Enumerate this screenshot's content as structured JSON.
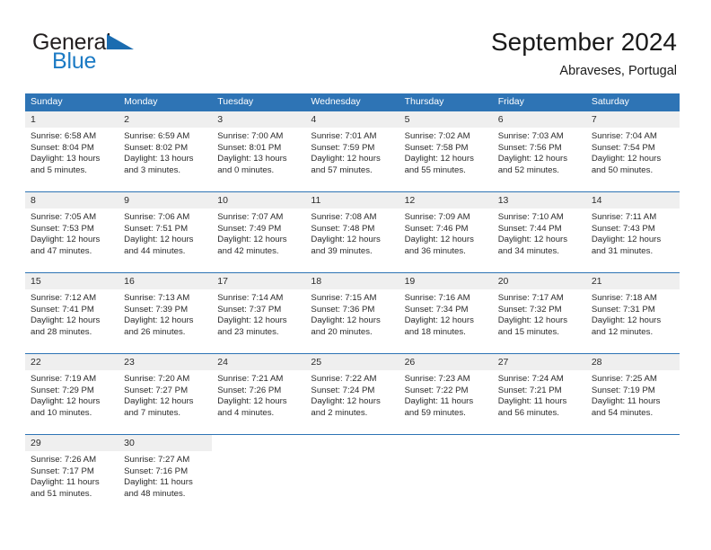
{
  "brand": {
    "name_part1": "General",
    "name_part2": "Blue",
    "flag_icon": "flag-triangle-icon",
    "color_dark": "#231f20",
    "color_blue": "#1b7ac4"
  },
  "header": {
    "title": "September 2024",
    "subtitle": "Abraveses, Portugal"
  },
  "colors": {
    "header_blue": "#2e74b5",
    "day_number_bg": "#efefef",
    "text": "#2b2b2b"
  },
  "weekdays": [
    "Sunday",
    "Monday",
    "Tuesday",
    "Wednesday",
    "Thursday",
    "Friday",
    "Saturday"
  ],
  "weeks": [
    [
      {
        "day": "1",
        "sunrise": "Sunrise: 6:58 AM",
        "sunset": "Sunset: 8:04 PM",
        "daylight": "Daylight: 13 hours and 5 minutes."
      },
      {
        "day": "2",
        "sunrise": "Sunrise: 6:59 AM",
        "sunset": "Sunset: 8:02 PM",
        "daylight": "Daylight: 13 hours and 3 minutes."
      },
      {
        "day": "3",
        "sunrise": "Sunrise: 7:00 AM",
        "sunset": "Sunset: 8:01 PM",
        "daylight": "Daylight: 13 hours and 0 minutes."
      },
      {
        "day": "4",
        "sunrise": "Sunrise: 7:01 AM",
        "sunset": "Sunset: 7:59 PM",
        "daylight": "Daylight: 12 hours and 57 minutes."
      },
      {
        "day": "5",
        "sunrise": "Sunrise: 7:02 AM",
        "sunset": "Sunset: 7:58 PM",
        "daylight": "Daylight: 12 hours and 55 minutes."
      },
      {
        "day": "6",
        "sunrise": "Sunrise: 7:03 AM",
        "sunset": "Sunset: 7:56 PM",
        "daylight": "Daylight: 12 hours and 52 minutes."
      },
      {
        "day": "7",
        "sunrise": "Sunrise: 7:04 AM",
        "sunset": "Sunset: 7:54 PM",
        "daylight": "Daylight: 12 hours and 50 minutes."
      }
    ],
    [
      {
        "day": "8",
        "sunrise": "Sunrise: 7:05 AM",
        "sunset": "Sunset: 7:53 PM",
        "daylight": "Daylight: 12 hours and 47 minutes."
      },
      {
        "day": "9",
        "sunrise": "Sunrise: 7:06 AM",
        "sunset": "Sunset: 7:51 PM",
        "daylight": "Daylight: 12 hours and 44 minutes."
      },
      {
        "day": "10",
        "sunrise": "Sunrise: 7:07 AM",
        "sunset": "Sunset: 7:49 PM",
        "daylight": "Daylight: 12 hours and 42 minutes."
      },
      {
        "day": "11",
        "sunrise": "Sunrise: 7:08 AM",
        "sunset": "Sunset: 7:48 PM",
        "daylight": "Daylight: 12 hours and 39 minutes."
      },
      {
        "day": "12",
        "sunrise": "Sunrise: 7:09 AM",
        "sunset": "Sunset: 7:46 PM",
        "daylight": "Daylight: 12 hours and 36 minutes."
      },
      {
        "day": "13",
        "sunrise": "Sunrise: 7:10 AM",
        "sunset": "Sunset: 7:44 PM",
        "daylight": "Daylight: 12 hours and 34 minutes."
      },
      {
        "day": "14",
        "sunrise": "Sunrise: 7:11 AM",
        "sunset": "Sunset: 7:43 PM",
        "daylight": "Daylight: 12 hours and 31 minutes."
      }
    ],
    [
      {
        "day": "15",
        "sunrise": "Sunrise: 7:12 AM",
        "sunset": "Sunset: 7:41 PM",
        "daylight": "Daylight: 12 hours and 28 minutes."
      },
      {
        "day": "16",
        "sunrise": "Sunrise: 7:13 AM",
        "sunset": "Sunset: 7:39 PM",
        "daylight": "Daylight: 12 hours and 26 minutes."
      },
      {
        "day": "17",
        "sunrise": "Sunrise: 7:14 AM",
        "sunset": "Sunset: 7:37 PM",
        "daylight": "Daylight: 12 hours and 23 minutes."
      },
      {
        "day": "18",
        "sunrise": "Sunrise: 7:15 AM",
        "sunset": "Sunset: 7:36 PM",
        "daylight": "Daylight: 12 hours and 20 minutes."
      },
      {
        "day": "19",
        "sunrise": "Sunrise: 7:16 AM",
        "sunset": "Sunset: 7:34 PM",
        "daylight": "Daylight: 12 hours and 18 minutes."
      },
      {
        "day": "20",
        "sunrise": "Sunrise: 7:17 AM",
        "sunset": "Sunset: 7:32 PM",
        "daylight": "Daylight: 12 hours and 15 minutes."
      },
      {
        "day": "21",
        "sunrise": "Sunrise: 7:18 AM",
        "sunset": "Sunset: 7:31 PM",
        "daylight": "Daylight: 12 hours and 12 minutes."
      }
    ],
    [
      {
        "day": "22",
        "sunrise": "Sunrise: 7:19 AM",
        "sunset": "Sunset: 7:29 PM",
        "daylight": "Daylight: 12 hours and 10 minutes."
      },
      {
        "day": "23",
        "sunrise": "Sunrise: 7:20 AM",
        "sunset": "Sunset: 7:27 PM",
        "daylight": "Daylight: 12 hours and 7 minutes."
      },
      {
        "day": "24",
        "sunrise": "Sunrise: 7:21 AM",
        "sunset": "Sunset: 7:26 PM",
        "daylight": "Daylight: 12 hours and 4 minutes."
      },
      {
        "day": "25",
        "sunrise": "Sunrise: 7:22 AM",
        "sunset": "Sunset: 7:24 PM",
        "daylight": "Daylight: 12 hours and 2 minutes."
      },
      {
        "day": "26",
        "sunrise": "Sunrise: 7:23 AM",
        "sunset": "Sunset: 7:22 PM",
        "daylight": "Daylight: 11 hours and 59 minutes."
      },
      {
        "day": "27",
        "sunrise": "Sunrise: 7:24 AM",
        "sunset": "Sunset: 7:21 PM",
        "daylight": "Daylight: 11 hours and 56 minutes."
      },
      {
        "day": "28",
        "sunrise": "Sunrise: 7:25 AM",
        "sunset": "Sunset: 7:19 PM",
        "daylight": "Daylight: 11 hours and 54 minutes."
      }
    ],
    [
      {
        "day": "29",
        "sunrise": "Sunrise: 7:26 AM",
        "sunset": "Sunset: 7:17 PM",
        "daylight": "Daylight: 11 hours and 51 minutes."
      },
      {
        "day": "30",
        "sunrise": "Sunrise: 7:27 AM",
        "sunset": "Sunset: 7:16 PM",
        "daylight": "Daylight: 11 hours and 48 minutes."
      },
      {
        "day": "",
        "sunrise": "",
        "sunset": "",
        "daylight": ""
      },
      {
        "day": "",
        "sunrise": "",
        "sunset": "",
        "daylight": ""
      },
      {
        "day": "",
        "sunrise": "",
        "sunset": "",
        "daylight": ""
      },
      {
        "day": "",
        "sunrise": "",
        "sunset": "",
        "daylight": ""
      },
      {
        "day": "",
        "sunrise": "",
        "sunset": "",
        "daylight": ""
      }
    ]
  ]
}
